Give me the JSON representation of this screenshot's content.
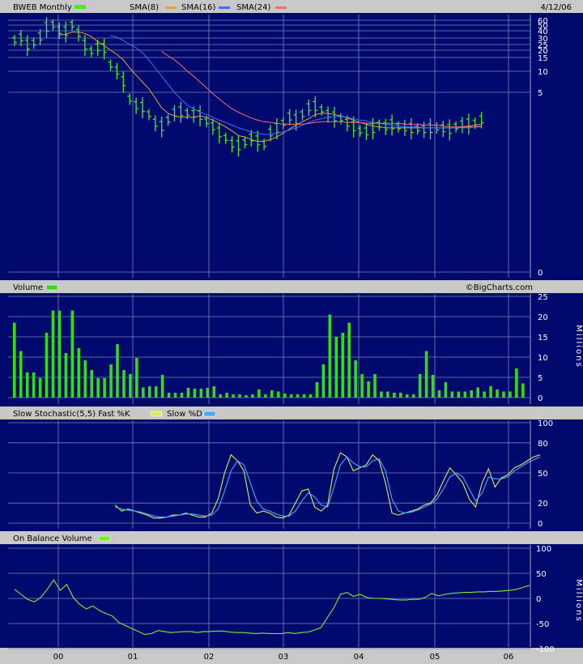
{
  "header": {
    "symbol_label": "BWEB Monthly",
    "sma8_label": "SMA(8)",
    "sma16_label": "SMA(16)",
    "sma24_label": "SMA(24)",
    "date": "4/12/06"
  },
  "panels": {
    "volume_label": "Volume",
    "volume_units": "Millions",
    "credit": "©BigCharts.com",
    "stoch_label": "Slow Stochastic(5,5) Fast %K",
    "stoch_slow_label": "Slow %D",
    "obv_label": "On Balance Volume",
    "obv_units": "Millions"
  },
  "colors": {
    "background": "#000a6e",
    "header_bar": "#c8c8c8",
    "price": "#44ee22",
    "sma8": "#e8a038",
    "sma16": "#3a70ff",
    "sma24": "#f07070",
    "volume": "#33dd11",
    "fastK": "#ddee55",
    "slowD": "#44aaff",
    "obv": "#77ee33",
    "grid": "#7a80b8"
  },
  "chart_data": [
    {
      "type": "line",
      "title": "BWEB Monthly",
      "yscale": "log",
      "ylim": [
        0,
        60
      ],
      "y_ticks": [
        "60",
        "50",
        "40",
        "30",
        "25",
        "20",
        "15",
        "10",
        "5",
        "0"
      ],
      "x_ticks": [
        "00",
        "01",
        "02",
        "03",
        "04",
        "05",
        "06"
      ],
      "series": [
        {
          "name": "BWEB Monthly",
          "kind": "ohlc-bars",
          "values": [
            28,
            30,
            24,
            26,
            31,
            45,
            50,
            40,
            38,
            50,
            36,
            24,
            19,
            22,
            21,
            12,
            10,
            7,
            4,
            3.2,
            3.0,
            2.4,
            1.8,
            1.6,
            2.0,
            2.5,
            2.6,
            2.5,
            2.4,
            2.3,
            1.9,
            1.6,
            1.3,
            1.1,
            0.9,
            0.85,
            0.95,
            1.1,
            1.0,
            0.9,
            1.3,
            1.5,
            1.8,
            2.2,
            2.0,
            2.4,
            3.0,
            3.1,
            2.8,
            2.4,
            2.2,
            2.1,
            1.8,
            1.6,
            1.4,
            1.35,
            1.5,
            1.7,
            1.6,
            1.7,
            1.6,
            1.55,
            1.5,
            1.5,
            1.45,
            1.5,
            1.55,
            1.5,
            1.45,
            1.6,
            1.7,
            1.75,
            1.8,
            2.0
          ]
        },
        {
          "name": "SMA(8)",
          "values": [
            null,
            null,
            null,
            null,
            null,
            null,
            null,
            34,
            35,
            38,
            38,
            36,
            32,
            27,
            24,
            20,
            17,
            14,
            11,
            8.8,
            7.0,
            5.6,
            4.1,
            3.0,
            2.5,
            2.3,
            2.2,
            2.2,
            2.2,
            2.3,
            2.2,
            2.0,
            1.8,
            1.6,
            1.4,
            1.2,
            1.15,
            1.05,
            1.0,
            1.0,
            1.05,
            1.15,
            1.3,
            1.5,
            1.7,
            1.9,
            2.1,
            2.4,
            2.5,
            2.5,
            2.4,
            2.3,
            2.15,
            2.0,
            1.85,
            1.75,
            1.65,
            1.6,
            1.55,
            1.55,
            1.55,
            1.55,
            1.55,
            1.55,
            1.55,
            1.55,
            1.55,
            1.55,
            1.55,
            1.55,
            1.6,
            1.65,
            1.7,
            1.75
          ]
        },
        {
          "name": "SMA(16)",
          "values": [
            null,
            null,
            null,
            null,
            null,
            null,
            null,
            null,
            null,
            null,
            null,
            null,
            null,
            null,
            null,
            33,
            31,
            28,
            25,
            22,
            18,
            14,
            11,
            8.5,
            6.5,
            5.0,
            4.0,
            3.3,
            2.9,
            2.6,
            2.4,
            2.2,
            2.0,
            1.85,
            1.7,
            1.55,
            1.45,
            1.35,
            1.3,
            1.25,
            1.25,
            1.3,
            1.35,
            1.45,
            1.55,
            1.7,
            1.85,
            2.0,
            2.1,
            2.2,
            2.25,
            2.25,
            2.2,
            2.1,
            2.0,
            1.95,
            1.85,
            1.8,
            1.75,
            1.7,
            1.65,
            1.6,
            1.6,
            1.6,
            1.55,
            1.55,
            1.55,
            1.55,
            1.55,
            1.55,
            1.55,
            1.55,
            1.6,
            1.65
          ]
        },
        {
          "name": "SMA(24)",
          "values": [
            null,
            null,
            null,
            null,
            null,
            null,
            null,
            null,
            null,
            null,
            null,
            null,
            null,
            null,
            null,
            null,
            null,
            null,
            null,
            null,
            null,
            null,
            null,
            19,
            16,
            14,
            12,
            10,
            8.5,
            7.0,
            5.8,
            4.8,
            4.0,
            3.4,
            2.9,
            2.6,
            2.35,
            2.15,
            2.0,
            1.9,
            1.85,
            1.8,
            1.75,
            1.75,
            1.75,
            1.75,
            1.8,
            1.85,
            1.9,
            1.9,
            1.9,
            1.9,
            1.85,
            1.85,
            1.85,
            1.8,
            1.8,
            1.8,
            1.8,
            1.8,
            1.8,
            1.75,
            1.75,
            1.75,
            1.7,
            1.7,
            1.7,
            1.65,
            1.6,
            1.6,
            1.6,
            1.6,
            1.6,
            1.6
          ]
        }
      ]
    },
    {
      "type": "bar",
      "title": "Volume",
      "ylabel": "Millions",
      "ylim": [
        0,
        25
      ],
      "y_ticks": [
        "25",
        "20",
        "15",
        "10",
        "5",
        "0"
      ],
      "x_ticks": [
        "00",
        "01",
        "02",
        "03",
        "04",
        "05",
        "06"
      ],
      "series": [
        {
          "name": "Volume",
          "values": [
            18.5,
            11.5,
            6.2,
            6.2,
            4.8,
            16,
            21.5,
            21.5,
            11,
            21.5,
            12.2,
            9.2,
            6.8,
            4.8,
            4.8,
            8.2,
            13.2,
            6.8,
            5.8,
            9.8,
            2.5,
            2.8,
            2.8,
            5.6,
            1.2,
            1.2,
            1.2,
            2.4,
            2.2,
            2.2,
            2.4,
            2.8,
            0.8,
            1.2,
            0.8,
            0.8,
            0.6,
            0.8,
            2.0,
            0.8,
            1.8,
            1.5,
            1.0,
            0.8,
            0.8,
            0.8,
            0.8,
            3.8,
            8.2,
            20.5,
            15,
            16,
            18.5,
            9.2,
            5.8,
            4.0,
            5.8,
            1.5,
            1.5,
            1.2,
            1.2,
            0.8,
            0.8,
            5.8,
            11.5,
            5.6,
            1.8,
            3.8,
            1.5,
            1.5,
            1.5,
            1.8,
            2.5,
            1.5,
            2.8,
            2.0,
            1.5,
            1.5,
            7.2,
            3.5
          ]
        }
      ]
    },
    {
      "type": "line",
      "title": "Slow Stochastic(5,5)",
      "ylim": [
        0,
        100
      ],
      "y_ticks": [
        "100",
        "80",
        "50",
        "20",
        "0"
      ],
      "x_ticks": [
        "00",
        "01",
        "02",
        "03",
        "04",
        "05",
        "06"
      ],
      "series": [
        {
          "name": "Fast %K",
          "values": [
            null,
            null,
            null,
            null,
            null,
            null,
            null,
            null,
            null,
            null,
            null,
            null,
            null,
            null,
            null,
            null,
            18,
            12,
            14,
            12,
            10,
            8,
            5,
            5,
            6,
            8,
            8,
            10,
            8,
            6,
            6,
            10,
            24,
            50,
            68,
            62,
            52,
            18,
            10,
            12,
            10,
            6,
            5,
            8,
            20,
            32,
            34,
            16,
            12,
            18,
            54,
            70,
            66,
            52,
            55,
            58,
            68,
            62,
            40,
            10,
            8,
            10,
            12,
            14,
            18,
            20,
            28,
            42,
            55,
            48,
            40,
            24,
            16,
            40,
            54,
            36,
            45,
            48,
            55,
            58,
            62,
            66,
            68
          ]
        },
        {
          "name": "Slow %D",
          "values": [
            null,
            null,
            null,
            null,
            null,
            null,
            null,
            null,
            null,
            null,
            null,
            null,
            null,
            null,
            null,
            null,
            16,
            14,
            13,
            12,
            11,
            9,
            7,
            6,
            6,
            7,
            8,
            9,
            9,
            8,
            7,
            8,
            14,
            32,
            52,
            62,
            58,
            40,
            22,
            14,
            12,
            9,
            7,
            7,
            12,
            22,
            30,
            26,
            18,
            16,
            36,
            58,
            66,
            60,
            56,
            56,
            62,
            64,
            52,
            24,
            12,
            10,
            11,
            13,
            16,
            19,
            24,
            34,
            46,
            50,
            46,
            34,
            22,
            30,
            46,
            44,
            44,
            46,
            52,
            56,
            60,
            63,
            66
          ]
        }
      ]
    },
    {
      "type": "line",
      "title": "On Balance Volume",
      "ylabel": "Millions",
      "ylim": [
        -100,
        100
      ],
      "y_ticks": [
        "100",
        "50",
        "0",
        "-50",
        "-100"
      ],
      "x_ticks": [
        "00",
        "01",
        "02",
        "03",
        "04",
        "05",
        "06"
      ],
      "series": [
        {
          "name": "On Balance Volume",
          "values": [
            18,
            8,
            -2,
            -7,
            2,
            18,
            37,
            16,
            28,
            2,
            -12,
            -21,
            -15,
            -24,
            -30,
            -35,
            -48,
            -54,
            -60,
            -66,
            -72,
            -70,
            -64,
            -66,
            -68,
            -67,
            -66,
            -66,
            -68,
            -66,
            -66,
            -65,
            -65,
            -67,
            -68,
            -68,
            -69,
            -70,
            -69,
            -70,
            -70,
            -70,
            -68,
            -70,
            -68,
            -67,
            -63,
            -58,
            -38,
            -18,
            8,
            12,
            4,
            8,
            2,
            0,
            0,
            -1,
            -2,
            -3,
            -3,
            -2,
            -2,
            2,
            10,
            5,
            8,
            10,
            11,
            12,
            12,
            13,
            13,
            14,
            14,
            15,
            16,
            18,
            22,
            26
          ]
        }
      ]
    }
  ]
}
